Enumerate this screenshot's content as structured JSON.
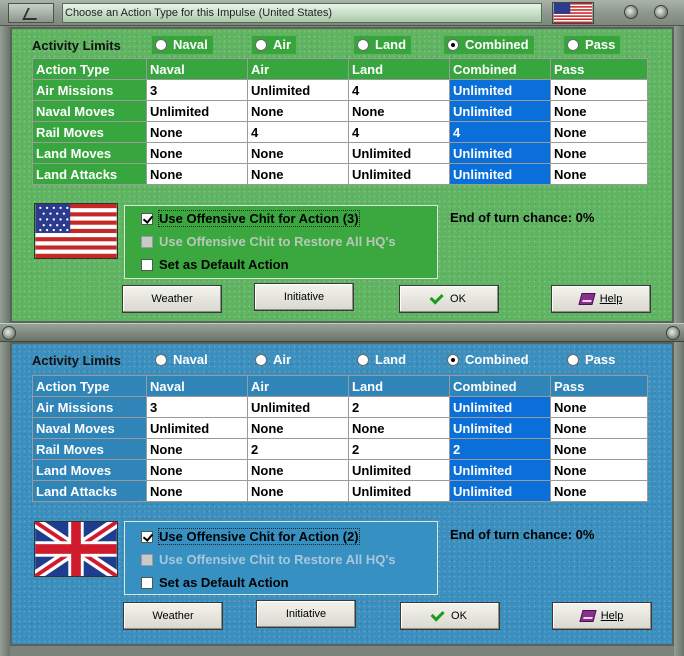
{
  "window": {
    "title": "Choose an Action Type for this Impulse (United States)",
    "title_flag_icon": "us-flag-icon"
  },
  "colors": {
    "us_panel": "#5fb462",
    "uk_panel": "#3b8fbf",
    "selected_column": "#0a6fd8"
  },
  "panels": [
    {
      "id": "us",
      "country_flag_icon": "us-flag-icon",
      "activity_limits_label": "Activity Limits",
      "radios": [
        {
          "label": "Naval",
          "checked": false
        },
        {
          "label": "Air",
          "checked": false
        },
        {
          "label": "Land",
          "checked": false
        },
        {
          "label": "Combined",
          "checked": true
        },
        {
          "label": "Pass",
          "checked": false
        }
      ],
      "table": {
        "headers": [
          "Action Type",
          "Naval",
          "Air",
          "Land",
          "Combined",
          "Pass"
        ],
        "selected_column": 4,
        "rows": [
          [
            "Air Missions",
            "3",
            "Unlimited",
            "4",
            "Unlimited",
            "None"
          ],
          [
            "Naval Moves",
            "Unlimited",
            "None",
            "None",
            "Unlimited",
            "None"
          ],
          [
            "Rail Moves",
            "None",
            "4",
            "4",
            "4",
            "None"
          ],
          [
            "Land Moves",
            "None",
            "None",
            "Unlimited",
            "Unlimited",
            "None"
          ],
          [
            "Land Attacks",
            "None",
            "None",
            "Unlimited",
            "Unlimited",
            "None"
          ]
        ]
      },
      "checkboxes": [
        {
          "label": "Use Offensive Chit for Action (3)",
          "checked": true,
          "enabled": true
        },
        {
          "label": "Use Offensive Chit to Restore All HQ's",
          "checked": false,
          "enabled": false
        },
        {
          "label": "Set as Default Action",
          "checked": false,
          "enabled": true
        }
      ],
      "end_of_turn": "End of turn chance: 0%",
      "buttons": {
        "weather": "Weather",
        "initiative": "Initiative",
        "ok": "OK",
        "help": "Help"
      }
    },
    {
      "id": "uk",
      "country_flag_icon": "uk-flag-icon",
      "activity_limits_label": "Activity Limits",
      "radios": [
        {
          "label": "Naval",
          "checked": false
        },
        {
          "label": "Air",
          "checked": false
        },
        {
          "label": "Land",
          "checked": false
        },
        {
          "label": "Combined",
          "checked": true
        },
        {
          "label": "Pass",
          "checked": false
        }
      ],
      "table": {
        "headers": [
          "Action Type",
          "Naval",
          "Air",
          "Land",
          "Combined",
          "Pass"
        ],
        "selected_column": 4,
        "rows": [
          [
            "Air Missions",
            "3",
            "Unlimited",
            "2",
            "Unlimited",
            "None"
          ],
          [
            "Naval Moves",
            "Unlimited",
            "None",
            "None",
            "Unlimited",
            "None"
          ],
          [
            "Rail Moves",
            "None",
            "2",
            "2",
            "2",
            "None"
          ],
          [
            "Land Moves",
            "None",
            "None",
            "Unlimited",
            "Unlimited",
            "None"
          ],
          [
            "Land Attacks",
            "None",
            "None",
            "Unlimited",
            "Unlimited",
            "None"
          ]
        ]
      },
      "checkboxes": [
        {
          "label": "Use Offensive Chit for Action (2)",
          "checked": true,
          "enabled": true
        },
        {
          "label": "Use Offensive Chit to Restore All HQ's",
          "checked": false,
          "enabled": false
        },
        {
          "label": "Set as Default Action",
          "checked": false,
          "enabled": true
        }
      ],
      "end_of_turn": "End of turn chance: 0%",
      "buttons": {
        "weather": "Weather",
        "initiative": "Initiative",
        "ok": "OK",
        "help": "Help"
      }
    }
  ]
}
